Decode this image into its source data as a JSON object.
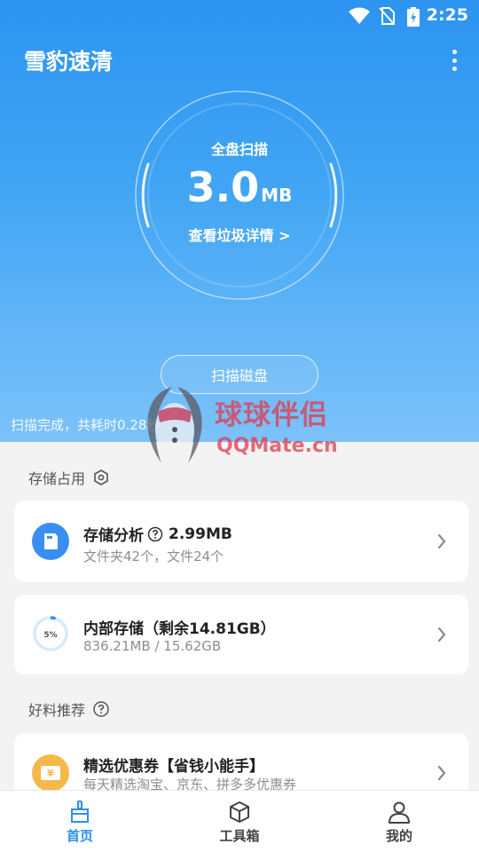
{
  "status_bar": {
    "time": "2:25"
  },
  "app": {
    "title": "雪豹速清"
  },
  "scan": {
    "label": "全盘扫描",
    "size_value": "3.0",
    "size_unit": "MB",
    "details_link": "查看垃圾详情 >",
    "button_label": "扫描磁盘",
    "status": "扫描完成，共耗时0.28秒"
  },
  "watermark": {
    "cn": "球球伴侣",
    "en": "QQMate.cn"
  },
  "storage_section": {
    "title": "存储占用",
    "analysis": {
      "title": "存储分析",
      "size": "2.99MB",
      "subtitle": "文件夹42个，文件24个"
    },
    "internal": {
      "title": "内部存储（剩余14.81GB）",
      "subtitle": "836.21MB / 15.62GB",
      "percent_label": "5%",
      "percent": 0.05
    }
  },
  "recommend_section": {
    "title": "好料推荐",
    "coupon": {
      "title": "精选优惠券【省钱小能手】",
      "subtitle": "每天精选淘宝、京东、拼多多优惠券",
      "icon_glyph": "¥"
    }
  },
  "bottom_nav": [
    {
      "label": "首页",
      "icon": "broom-icon",
      "active": true
    },
    {
      "label": "工具箱",
      "icon": "box-icon",
      "active": false
    },
    {
      "label": "我的",
      "icon": "user-icon",
      "active": false
    }
  ],
  "colors": {
    "accent": "#2d8ff0",
    "hero_top": "#2c94f1",
    "hero_bottom": "#7cc2fa",
    "watermark": "#e23a4e"
  }
}
